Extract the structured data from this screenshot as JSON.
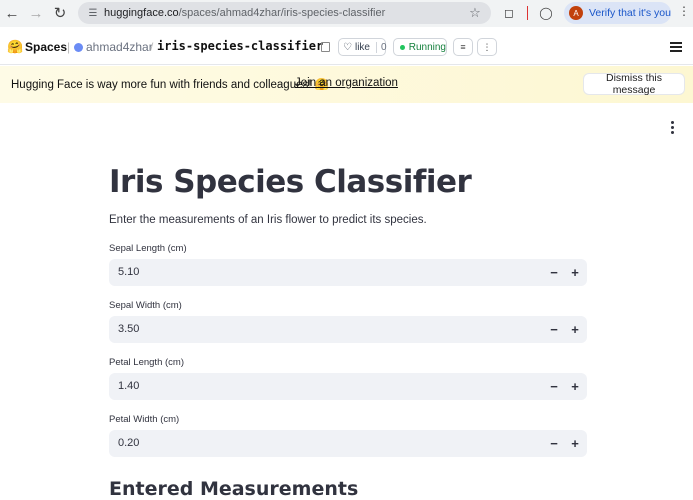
{
  "browser": {
    "url_host": "huggingface.co",
    "url_path": "/spaces/ahmad4zhar/iris-species-classifier",
    "verify_label": "Verify that it's you",
    "avatar_letter": "A"
  },
  "header": {
    "section": "Spaces",
    "owner": "ahmad4zhar",
    "repo": "iris-species-classifier",
    "like_label": "like",
    "like_count": "0",
    "status": "Running"
  },
  "banner": {
    "message": "Hugging Face is way more fun with friends and colleagues! 🤗",
    "link": "Join an organization",
    "dismiss": "Dismiss this message"
  },
  "app": {
    "title": "Iris Species Classifier",
    "subtitle": "Enter the measurements of an Iris flower to predict its species.",
    "fields": [
      {
        "label": "Sepal Length (cm)",
        "value": "5.10"
      },
      {
        "label": "Sepal Width (cm)",
        "value": "3.50"
      },
      {
        "label": "Petal Length (cm)",
        "value": "1.40"
      },
      {
        "label": "Petal Width (cm)",
        "value": "0.20"
      }
    ],
    "section_heading": "Entered Measurements"
  },
  "colors": {
    "accent_blue": "#1a56c9",
    "running_green": "#22c55e",
    "banner_bg": "#fdf7d2",
    "field_bg": "#f0f2f6",
    "text": "#31333f"
  }
}
